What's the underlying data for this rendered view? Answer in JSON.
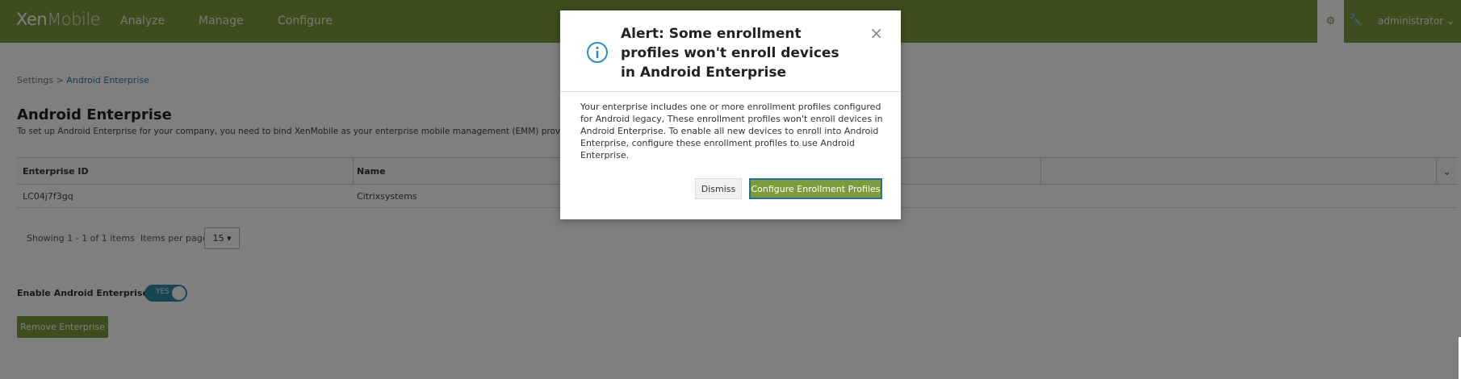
{
  "topnav": {
    "logo_bold": "Xen",
    "logo_thin": "Mobile",
    "items": [
      {
        "label": "Analyze"
      },
      {
        "label": "Manage"
      },
      {
        "label": "Configure"
      }
    ],
    "user_label": "administrator ⌄",
    "gear_icon": "gear-icon",
    "wrench_icon": "wrench-icon"
  },
  "breadcrumb": {
    "parent": "Settings",
    "separator": " > ",
    "current": "Android Enterprise"
  },
  "page": {
    "title": "Android Enterprise",
    "description": "To set up Android Enterprise for your company, you need to bind XenMobile as your enterprise mobile management (EMM) provider"
  },
  "table": {
    "columns": [
      "Enterprise ID",
      "Name"
    ],
    "rows": [
      {
        "enterprise_id": "LC04j7f3gq",
        "name": "Citrixsystems"
      }
    ]
  },
  "pagination": {
    "showing": "Showing 1 - 1 of 1 items",
    "items_per_page_label": "Items per page:",
    "items_per_page_value": "15 ▾"
  },
  "settings": {
    "enable_label": "Enable Android Enterprise",
    "toggle_text": "YES",
    "toggle_state": "on",
    "remove_button": "Remove Enterprise"
  },
  "modal": {
    "title": "Alert: Some enrollment profiles won't enroll devices in Android Enterprise",
    "body": "Your enterprise includes one or more enrollment profiles configured for Android legacy, These enrollment profiles won't enroll devices in Android Enterprise. To enable all new devices to enroll into Android Enterprise, configure these enrollment profiles to use Android Enterprise.",
    "close": "×",
    "dismiss_button": "Dismiss",
    "configure_button": "Configure Enrollment Profiles"
  },
  "colors": {
    "brand_green": "#7d9a3c",
    "link_blue": "#2c7fa0",
    "toggle_blue": "#2f8aa6",
    "focus_border": "#2a6f9b"
  }
}
